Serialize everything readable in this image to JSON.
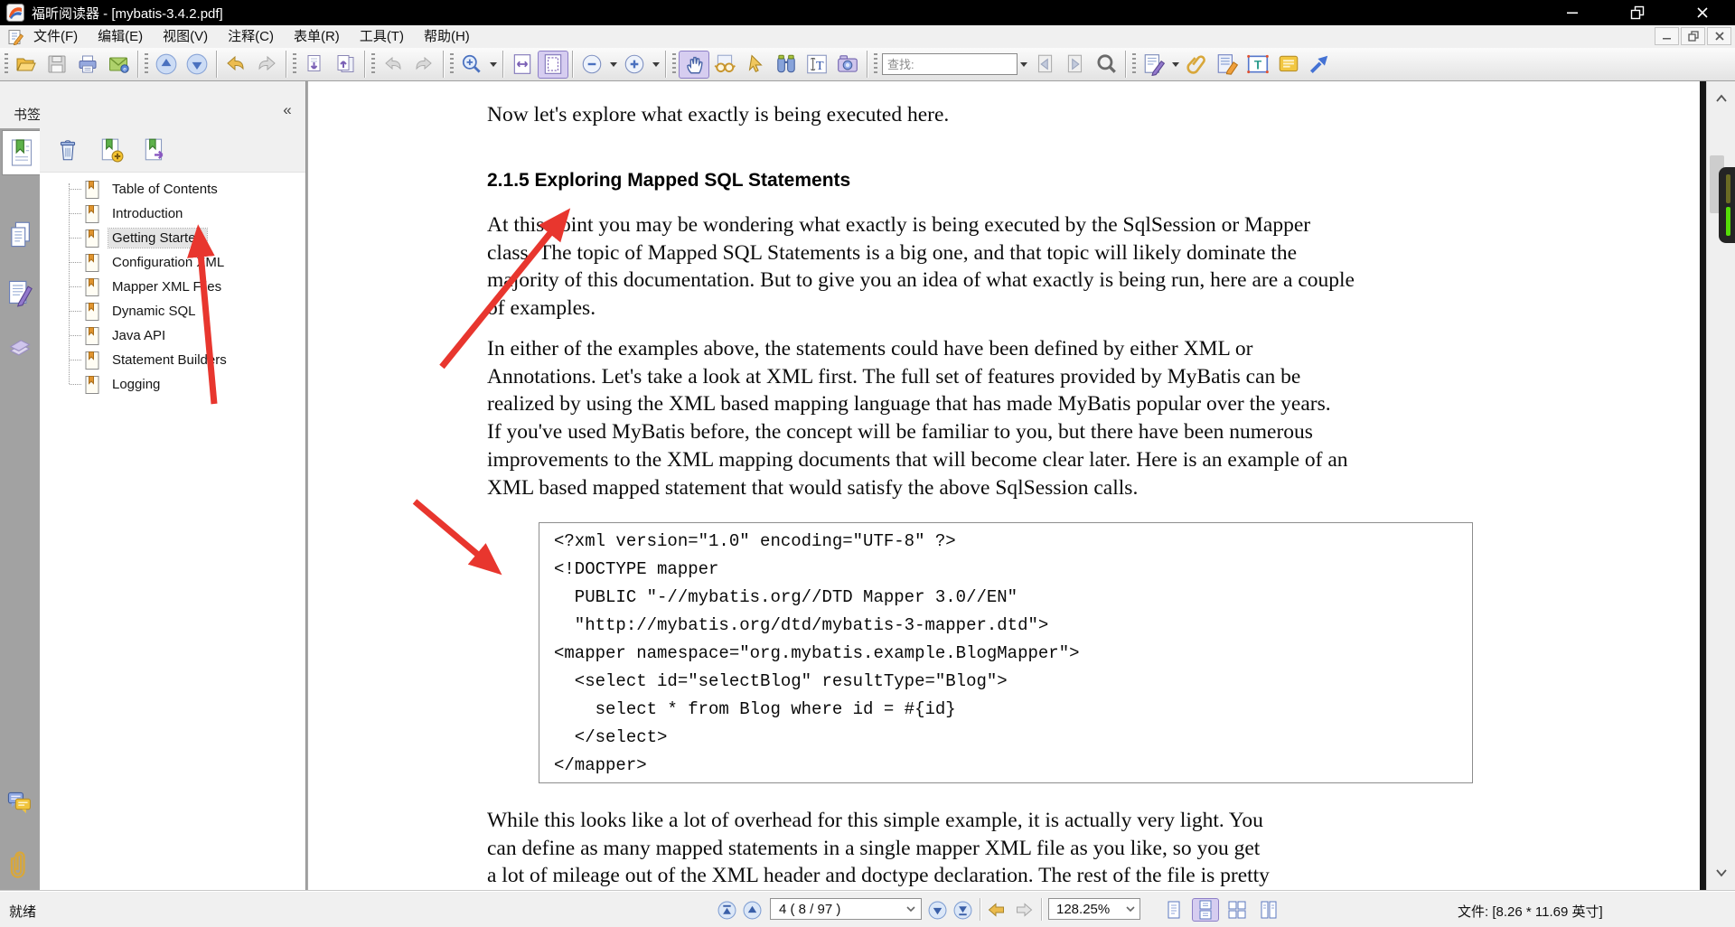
{
  "window": {
    "title": "福昕阅读器 - [mybatis-3.4.2.pdf]"
  },
  "menu": {
    "items": [
      "文件(F)",
      "编辑(E)",
      "视图(V)",
      "注释(C)",
      "表单(R)",
      "工具(T)",
      "帮助(H)"
    ]
  },
  "toolbar": {
    "find_placeholder": "查找:"
  },
  "sidebar": {
    "header": "书签",
    "selected_bookmark": "Getting Started",
    "bookmarks": [
      "Table of Contents",
      "Introduction",
      "Getting Started",
      "Configuration XML",
      "Mapper XML Files",
      "Dynamic SQL",
      "Java API",
      "Statement Builders",
      "Logging"
    ]
  },
  "document": {
    "intro": "Now let's explore what exactly is being executed here.",
    "heading": "2.1.5 Exploring Mapped SQL Statements",
    "para1": [
      "At this point you may be wondering what exactly is being executed by the SqlSession or Mapper",
      "class. The topic of Mapped SQL Statements is a big one, and that topic will likely dominate the",
      "majority of this documentation. But to give you an idea of what exactly is being run, here are a couple",
      "of examples."
    ],
    "para2": [
      "In either of the examples above, the statements could have been defined by either XML or",
      "Annotations. Let's take a look at XML first. The full set of features provided by MyBatis can be",
      "realized by using the XML based mapping language that has made MyBatis popular over the years.",
      "If you've used MyBatis before, the concept will be familiar to you, but there have been numerous",
      "improvements to the XML mapping documents that will become clear later. Here is an example of an",
      "XML based mapped statement that would satisfy the above SqlSession calls."
    ],
    "code": [
      "<?xml version=\"1.0\" encoding=\"UTF-8\" ?>",
      "<!DOCTYPE mapper",
      "  PUBLIC \"-//mybatis.org//DTD Mapper 3.0//EN\"",
      "  \"http://mybatis.org/dtd/mybatis-3-mapper.dtd\">",
      "<mapper namespace=\"org.mybatis.example.BlogMapper\">",
      "  <select id=\"selectBlog\" resultType=\"Blog\">",
      "    select * from Blog where id = #{id}",
      "  </select>",
      "</mapper>"
    ],
    "para3": [
      "While this looks like a lot of overhead for this simple example, it is actually very light. You",
      "can define as many mapped statements in a single mapper XML file as you like, so you get",
      "a lot of mileage out of the XML header and doctype declaration. The rest of the file is pretty"
    ]
  },
  "statusbar": {
    "ready": "就绪",
    "page_display": "4 ( 8 / 97 )",
    "zoom_level": "128.25%",
    "file_info": "文件: [8.26 * 11.69 英寸]"
  },
  "colors": {
    "titlebar": "#000000",
    "toolbar_selection": "#d6cdf0",
    "annotation_arrow": "#e8362e",
    "bookmark_ribbon": "#e0942f",
    "edge_indicator_green": "#55dc08"
  },
  "icons": {
    "open": "yellow-folder",
    "save": "floppy-disk",
    "print": "printer",
    "email": "green-envelope",
    "page_up": "circle-up-triangle",
    "page_down": "circle-down-triangle",
    "back": "gold-curved-left-arrow",
    "forward": "grey-curved-right-arrow",
    "prev_view": "page-down-arrow",
    "next_view": "page-up-arrow",
    "undo": "grey-curve-left",
    "redo": "grey-curve-right",
    "marquee_zoom": "magnifier-plus",
    "fit_width": "page-h-arrows",
    "fit_page": "page-frame",
    "zoom_out": "circle-minus",
    "zoom_in": "circle-plus",
    "hand_tool": "hand",
    "read_mode": "eyeglasses",
    "select_tool": "cursor-arrow",
    "search": "binoculars",
    "select_text": "text-I-beam",
    "snapshot": "camera",
    "find_prev": "page-left-triangle",
    "find_next": "page-right-triangle",
    "adv_search": "magnifier-ring",
    "note": "doc-pen",
    "attach": "paperclip",
    "highlight": "doc-marker",
    "textbox": "boxed-T",
    "comment": "yellow-note",
    "share": "blue-diagonal-arrow",
    "bookmarks_tab": "page-green-ribbon",
    "pages_tab": "stacked-pages",
    "annots_tab": "page-purple-pen",
    "layers_tab": "tilted-sheets",
    "comments_tab": "speech-bubbles",
    "attachments_tab": "paperclip",
    "delete_bookmark": "trash-can",
    "add_bookmark": "bookmark-plus",
    "export_bookmark": "bookmark-arrow",
    "bookmark_item": "page-gold-ribbon",
    "first_page": "circle-bar-up",
    "prev_page": "circle-up",
    "next_page": "circle-down",
    "last_page": "circle-bar-down",
    "layout_single": "one-page",
    "layout_continuous": "stacked-page",
    "layout_facing": "four-pages",
    "layout_cont_facing": "two-columns"
  }
}
